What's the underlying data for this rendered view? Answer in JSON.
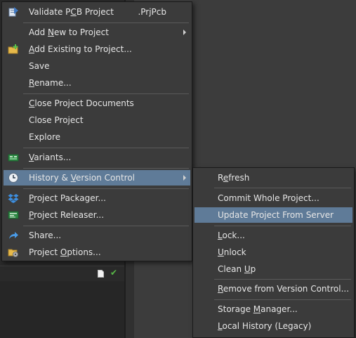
{
  "main_menu": {
    "items": [
      {
        "id": "validate",
        "label": "Validate PCB Project",
        "underline": "C",
        "shortcut": ".PrjPcb"
      },
      {
        "id": "add_new",
        "label": "Add New to Project",
        "underline": "N",
        "submenu": true
      },
      {
        "id": "add_existing",
        "label": "Add Existing to Project...",
        "underline": "A"
      },
      {
        "id": "save",
        "label": "Save"
      },
      {
        "id": "rename",
        "label": "Rename...",
        "underline": "R"
      },
      {
        "id": "close_docs",
        "label": "Close Project Documents",
        "underline": "C"
      },
      {
        "id": "close_project",
        "label": "Close Project"
      },
      {
        "id": "explore",
        "label": "Explore"
      },
      {
        "id": "variants",
        "label": "Variants...",
        "underline": "V"
      },
      {
        "id": "history",
        "label": "History & Version Control",
        "underline": "V",
        "submenu": true,
        "highlighted": true
      },
      {
        "id": "packager",
        "label": "Project Packager...",
        "underline": "P"
      },
      {
        "id": "releaser",
        "label": "Project Releaser...",
        "underline": "P"
      },
      {
        "id": "share",
        "label": "Share..."
      },
      {
        "id": "options",
        "label": "Project Options...",
        "underline": "O"
      }
    ]
  },
  "sub_menu": {
    "items": [
      {
        "id": "refresh",
        "label": "Refresh",
        "underline": "e"
      },
      {
        "id": "commit",
        "label": "Commit Whole Project..."
      },
      {
        "id": "update",
        "label": "Update Project From Server",
        "highlighted": true
      },
      {
        "id": "lock",
        "label": "Lock...",
        "underline": "L"
      },
      {
        "id": "unlock",
        "label": "Unlock",
        "underline": "U"
      },
      {
        "id": "cleanup",
        "label": "Clean Up",
        "underline": "U"
      },
      {
        "id": "remove",
        "label": "Remove from Version Control...",
        "underline": "R"
      },
      {
        "id": "storage",
        "label": "Storage Manager...",
        "underline": "M"
      },
      {
        "id": "local_history",
        "label": "Local History (Legacy)",
        "underline": "L"
      }
    ]
  },
  "icons": {
    "validate": "validate-project-icon",
    "add_existing": "add-existing-folder-icon",
    "variants": "variants-icon",
    "history": "history-clock-icon",
    "packager": "dropbox-packager-icon",
    "releaser": "releaser-icon",
    "share": "share-arrow-icon",
    "options": "project-options-icon"
  },
  "colors": {
    "menu_bg": "#3b3b3b",
    "highlight": "#5f7b98",
    "text": "#e6e6e6",
    "separator": "#5a5a5a",
    "status_check": "#58b947"
  }
}
